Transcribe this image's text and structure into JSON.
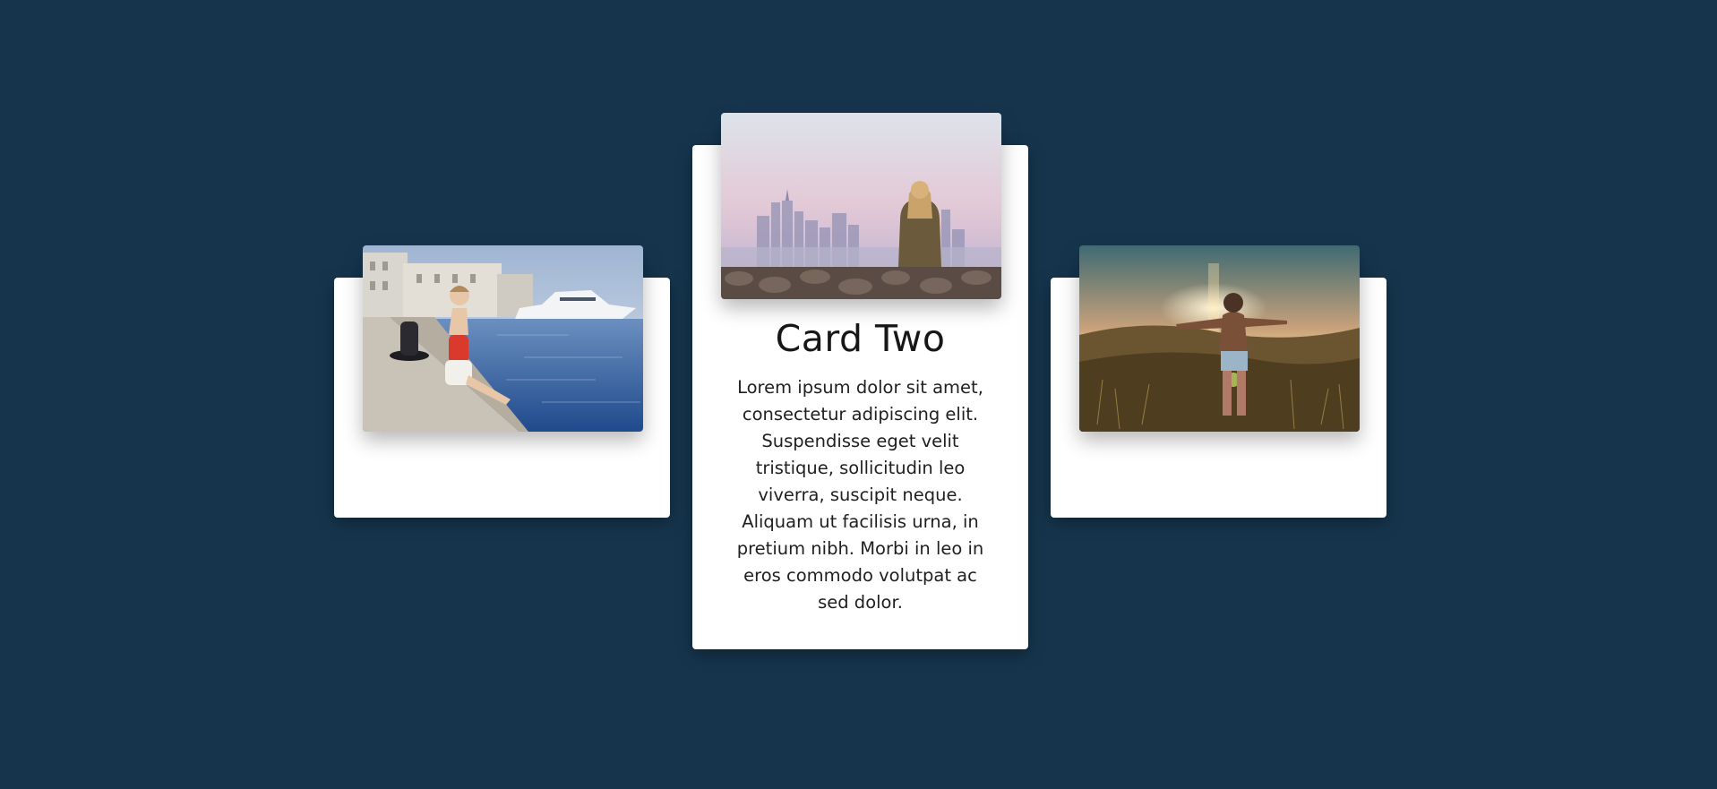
{
  "colors": {
    "background": "#16354d",
    "card": "#ffffff"
  },
  "cards": [
    {
      "title": "",
      "text": "",
      "image": "photo-woman-sitting-on-dock-by-harbor"
    },
    {
      "title": "Card Two",
      "text": "Lorem ipsum dolor sit amet, consectetur adipiscing elit. Suspendisse eget velit tristique, sollicitudin leo viverra, suscipit neque. Aliquam ut facilisis urna, in pretium nibh. Morbi in leo in eros commodo volutpat ac sed dolor.",
      "image": "photo-woman-overlooking-city-skyline"
    },
    {
      "title": "",
      "text": "",
      "image": "photo-woman-arms-outstretched-at-sunset"
    }
  ]
}
